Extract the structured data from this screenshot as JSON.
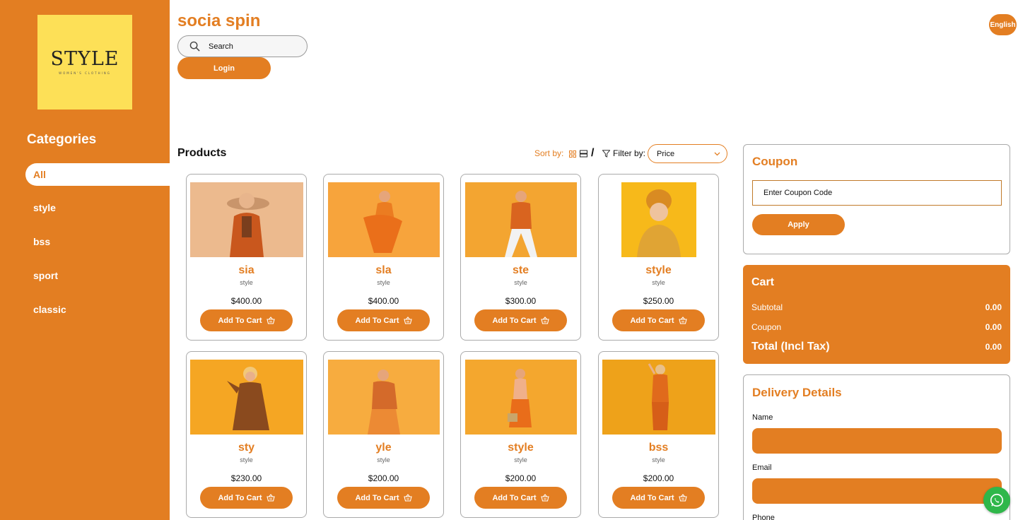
{
  "brand": "socia spin",
  "logo": {
    "word": "STYLE",
    "sub": "WOMEN'S CLOTHING"
  },
  "header": {
    "search_placeholder": "Search",
    "login_label": "Login",
    "language_label": "English"
  },
  "sidebar": {
    "title": "Categories",
    "items": [
      {
        "label": "All",
        "active": true
      },
      {
        "label": "style"
      },
      {
        "label": "bss"
      },
      {
        "label": "sport"
      },
      {
        "label": "classic"
      }
    ]
  },
  "products": {
    "title": "Products",
    "sort_label": "Sort by:",
    "slash": "/",
    "filter_label": "Filter by:",
    "filter_value": "Price",
    "add_to_cart_label": "Add To Cart",
    "items": [
      {
        "name": "sia",
        "category": "style",
        "price": "$400.00"
      },
      {
        "name": "sla",
        "category": "style",
        "price": "$400.00"
      },
      {
        "name": "ste",
        "category": "style",
        "price": "$300.00"
      },
      {
        "name": "style",
        "category": "style",
        "price": "$250.00"
      },
      {
        "name": "sty",
        "category": "style",
        "price": "$230.00"
      },
      {
        "name": "yle",
        "category": "style",
        "price": "$200.00"
      },
      {
        "name": "style",
        "category": "style",
        "price": "$200.00"
      },
      {
        "name": "bss",
        "category": "style",
        "price": "$200.00"
      }
    ]
  },
  "coupon": {
    "title": "Coupon",
    "placeholder": "Enter Coupon Code",
    "apply_label": "Apply"
  },
  "cart": {
    "title": "Cart",
    "subtotal_label": "Subtotal",
    "subtotal_value": "0.00",
    "coupon_label": "Coupon",
    "coupon_value": "0.00",
    "total_label": "Total (Incl Tax)",
    "total_value": "0.00"
  },
  "delivery": {
    "title": "Delivery Details",
    "name_label": "Name",
    "email_label": "Email",
    "phone_label": "Phone"
  },
  "colors": {
    "accent": "#e37e22",
    "logo_bg": "#fde057",
    "whatsapp": "#2fb74a"
  }
}
